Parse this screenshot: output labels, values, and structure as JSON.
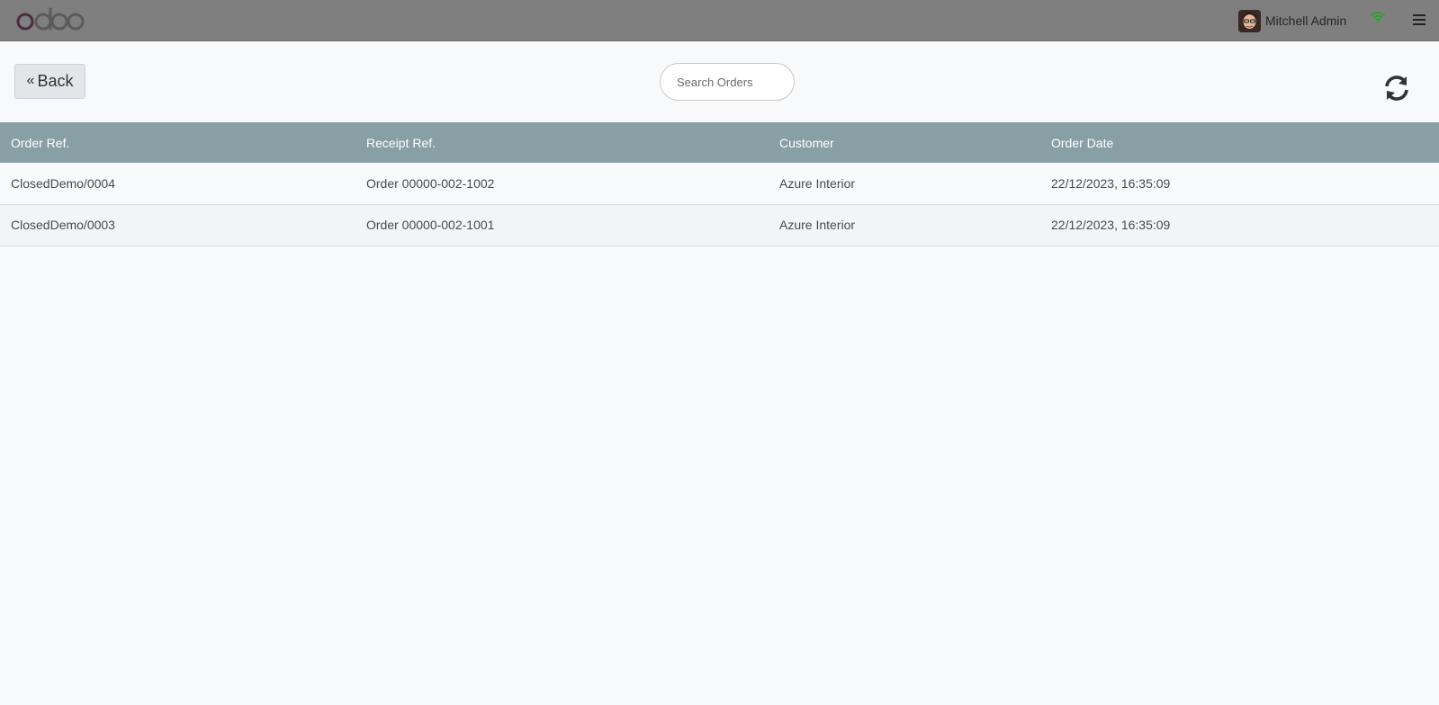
{
  "header": {
    "logo_text": "odoo",
    "user_name": "Mitchell Admin",
    "icons": {
      "avatar": "avatar-image",
      "network": "wifi-icon",
      "menu": "hamburger-menu-icon"
    },
    "colors": {
      "topbar": "#7f7f7f",
      "wifi": "#2aa12a"
    }
  },
  "toolbar": {
    "back_label": "Back",
    "back_icon": "double-chevron-left-icon",
    "search_placeholder": "Search Orders",
    "search_value": "",
    "refresh_icon": "refresh-icon"
  },
  "orders_table": {
    "header_color": "#889fa6",
    "columns": [
      "Order Ref.",
      "Receipt Ref.",
      "Customer",
      "Order Date"
    ],
    "rows": [
      [
        "ClosedDemo/0004",
        "Order 00000-002-1002",
        "Azure Interior",
        "22/12/2023, 16:35:09"
      ],
      [
        "ClosedDemo/0003",
        "Order 00000-002-1001",
        "Azure Interior",
        "22/12/2023, 16:35:09"
      ]
    ]
  }
}
